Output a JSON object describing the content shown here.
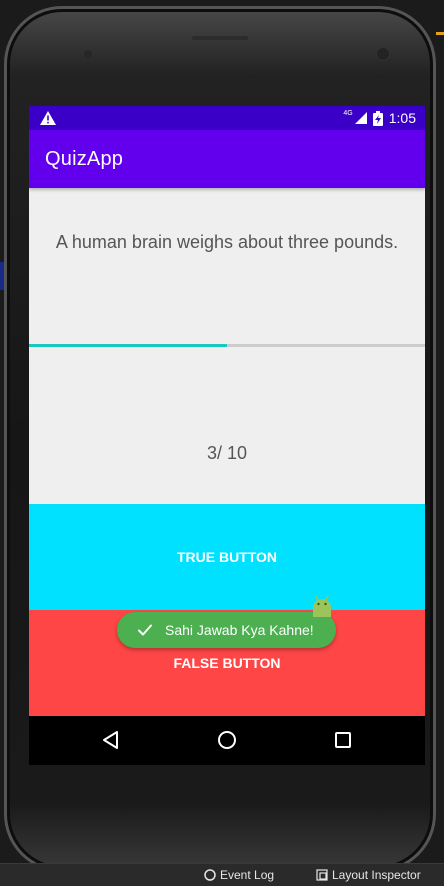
{
  "status_bar": {
    "network_label": "4G",
    "time": "1:05"
  },
  "app": {
    "title": "QuizApp"
  },
  "quiz": {
    "question": "A human brain weighs about three pounds.",
    "progress_fraction": 0.5,
    "score_text": "3/ 10"
  },
  "buttons": {
    "true_label": "TRUE BUTTON",
    "false_label": "FALSE BUTTON"
  },
  "toast": {
    "message": "Sahi Jawab Kya Kahne!"
  },
  "ide": {
    "event_log_label": "Event Log",
    "layout_inspector_label": "Layout Inspector"
  },
  "colors": {
    "status_bar": "#3a00c7",
    "app_bar": "#6200ee",
    "true_button": "#00e1ff",
    "false_button": "#ff4646",
    "toast": "#4caf50",
    "progress": "#17c9c0"
  },
  "icons": {
    "status_left": "warning-icon",
    "signal": "signal-icon",
    "battery": "battery-icon",
    "nav_back": "back-icon",
    "nav_home": "home-icon",
    "nav_recents": "recents-icon",
    "toast": "check-icon",
    "mascot": "android-icon"
  }
}
